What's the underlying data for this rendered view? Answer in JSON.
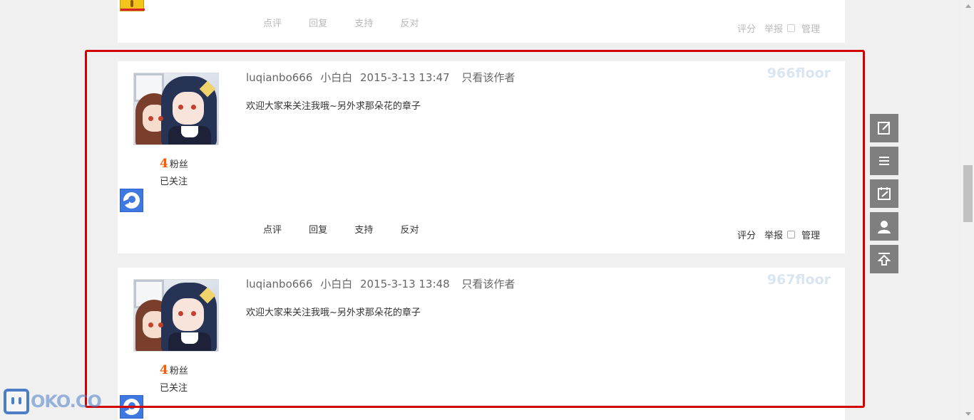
{
  "colors": {
    "accent_red": "#d40000",
    "fans_orange": "#ff5a00",
    "floor_text": "#d9e6f2",
    "toolbar_bg": "#7f7f7f"
  },
  "top_post": {
    "actions": [
      "点评",
      "回复",
      "支持",
      "反对"
    ],
    "meta": {
      "rate": "评分",
      "report": "举报",
      "manage": "管理"
    }
  },
  "posts": [
    {
      "author": "luqianbo666",
      "nickname": "小白白",
      "datetime": "2015-3-13 13:47",
      "only_author": "只看该作者",
      "floor": "966floor",
      "content": "欢迎大家来关注我哦~另外求那朵花的章子",
      "fans_count": "4",
      "fans_label": "粉丝",
      "follow_status": "已关注",
      "actions": [
        "点评",
        "回复",
        "支持",
        "反对"
      ],
      "meta": {
        "rate": "评分",
        "report": "举报",
        "manage": "管理"
      }
    },
    {
      "author": "luqianbo666",
      "nickname": "小白白",
      "datetime": "2015-3-13 13:48",
      "only_author": "只看该作者",
      "floor": "967floor",
      "content": "欢迎大家来关注我哦~另外求那朵花的章子",
      "fans_count": "4",
      "fans_label": "粉丝",
      "follow_status": "已关注"
    }
  ],
  "side_toolbar": {
    "icons": [
      "edit-icon",
      "menu-icon",
      "new-post-icon",
      "user-icon",
      "back-to-top-icon"
    ]
  },
  "watermark": {
    "text": "OKO.CO"
  }
}
